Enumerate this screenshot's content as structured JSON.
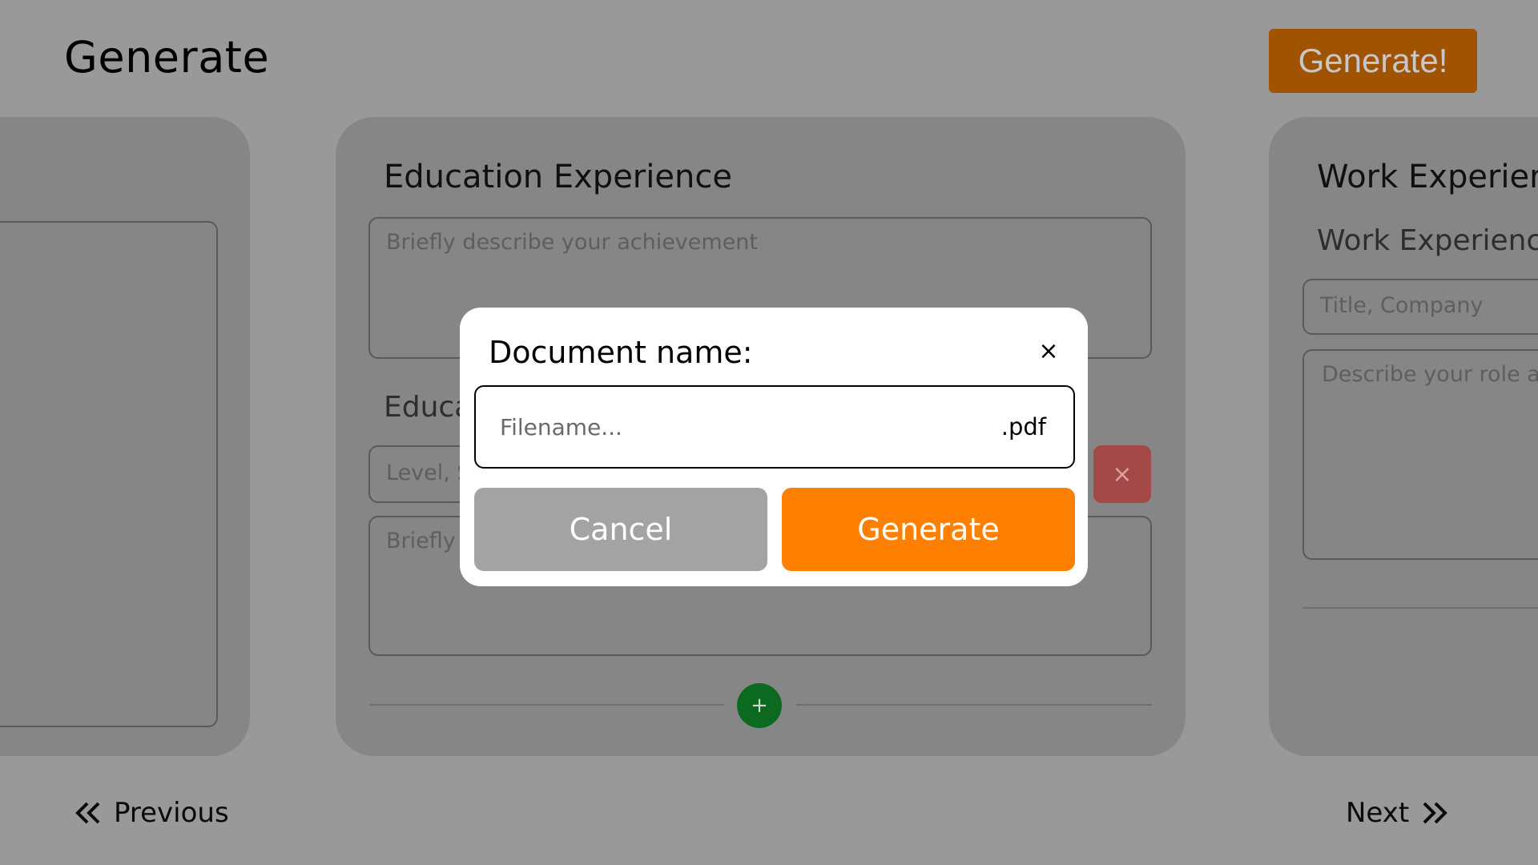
{
  "header": {
    "title": "Generate",
    "generate_button": "Generate!"
  },
  "education_card": {
    "title": "Education Experience",
    "achievement_placeholder": "Briefly describe your achievement",
    "entry_title_partial": "Educa",
    "level_placeholder_partial": "Level, S",
    "briefly_partial": "Briefly",
    "remove_icon": "×",
    "add_icon": "+"
  },
  "work_card": {
    "title": "Work Experien",
    "subtitle": "Work Experienc",
    "title_company_placeholder": "Title, Company",
    "describe_placeholder": "Describe your role ar"
  },
  "navigation": {
    "previous": "Previous",
    "next": "Next"
  },
  "modal": {
    "title": "Document name:",
    "close_icon": "×",
    "filename_placeholder": "Filename...",
    "extension": ".pdf",
    "cancel": "Cancel",
    "generate": "Generate"
  },
  "colors": {
    "overlay_background": "#999999",
    "card": "#868686",
    "generate_orange": "#ff8000",
    "remove_red": "#a44848",
    "add_green": "#0b6a1f"
  }
}
